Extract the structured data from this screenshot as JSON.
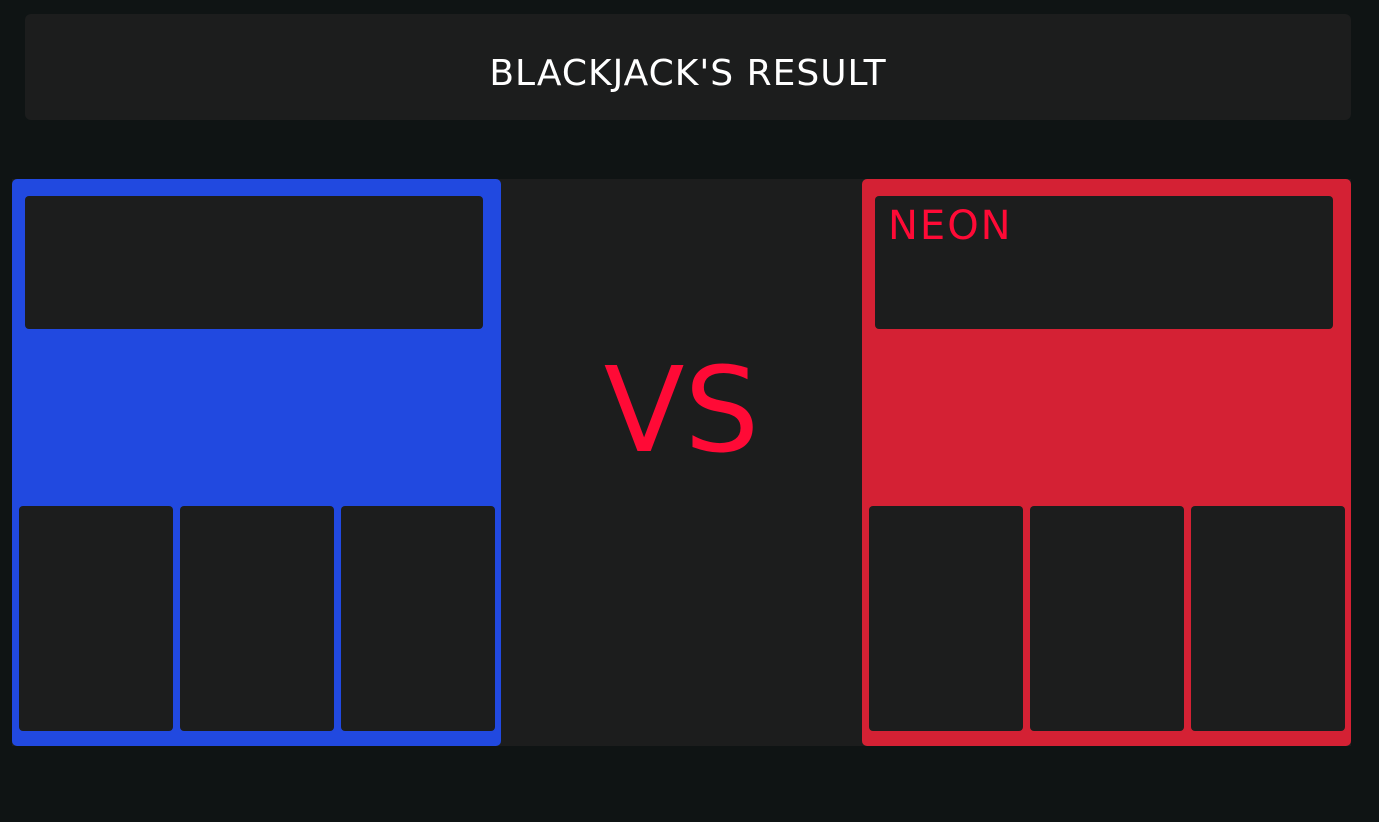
{
  "header": {
    "title": "BLACKJACK'S RESULT"
  },
  "colors": {
    "page_background": "#0f1414",
    "panel_dark": "#1c1d1d",
    "player_left_color": "#2149e0",
    "player_right_color": "#d42134",
    "vs_color": "#ff0a36",
    "title_color": "#ffffff"
  },
  "vs_label": "VS",
  "players": {
    "left": {
      "name": "",
      "cards": [
        "",
        "",
        ""
      ]
    },
    "right": {
      "name": "NEON",
      "cards": [
        "",
        "",
        ""
      ]
    }
  }
}
